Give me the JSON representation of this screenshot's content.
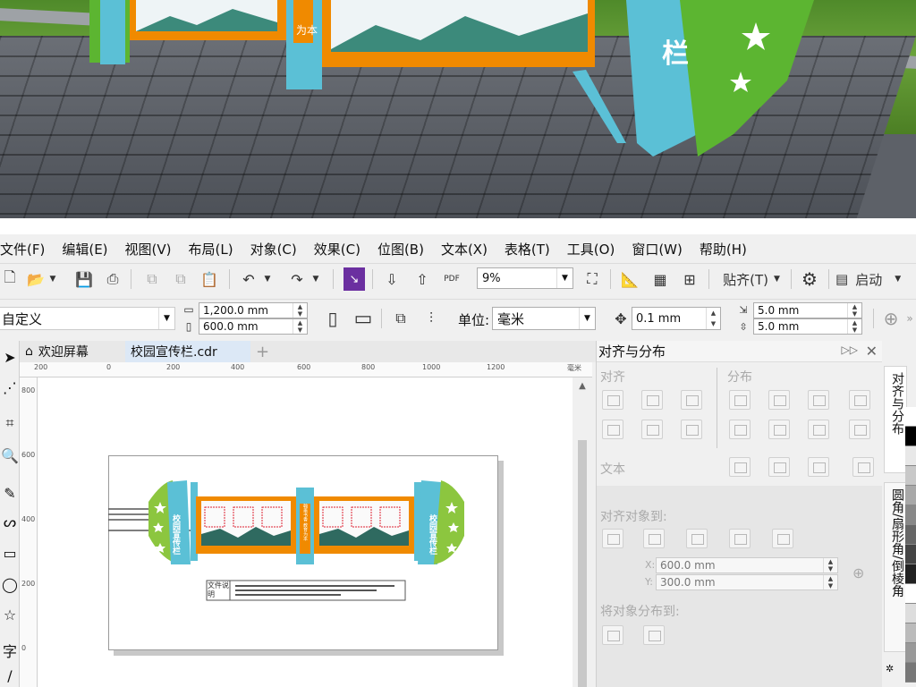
{
  "menu": [
    "文件(F)",
    "编辑(E)",
    "视图(V)",
    "布局(L)",
    "对象(C)",
    "效果(C)",
    "位图(B)",
    "文本(X)",
    "表格(T)",
    "工具(O)",
    "窗口(W)",
    "帮助(H)"
  ],
  "toolbar1": {
    "zoom": "9%",
    "snap_label": "贴齐(T)",
    "launch_label": "启动",
    "pdf_label": "PDF"
  },
  "toolbar2": {
    "preset": "自定义",
    "width": "1,200.0 mm",
    "height": "600.0 mm",
    "units_label": "单位:",
    "units_value": "毫米",
    "nudge": "0.1 mm",
    "dup_x": "5.0 mm",
    "dup_y": "5.0 mm"
  },
  "tabs": {
    "welcome": "欢迎屏幕",
    "document": "校园宣传栏.cdr"
  },
  "ruler": {
    "h_ticks": [
      "200",
      "0",
      "200",
      "400",
      "600",
      "800",
      "1000",
      "1200"
    ],
    "h_unit": "毫米",
    "v_ticks": [
      "800",
      "600",
      "400",
      "200",
      "0"
    ]
  },
  "artwork": {
    "side_title": "校园宣传栏",
    "side_title_right": "校园宣传栏",
    "center_text": "为本",
    "center_strip": "翰墨书香 教育为本",
    "caption_label": "文件说明"
  },
  "docker": {
    "title": "对齐与分布",
    "align_label": "对齐",
    "distribute_label": "分布",
    "text_label": "文本",
    "align_to_label": "对齐对象到:",
    "x_label": "X:",
    "x_value": "600.0 mm",
    "y_label": "Y:",
    "y_value": "300.0 mm",
    "distribute_to_label": "将对象分布到:"
  },
  "side_tabs": [
    "对齐与分布",
    "圆角/扇形角/倒棱角"
  ],
  "colors": {
    "accent": "#f08a00",
    "teal": "#5bc0d6",
    "green": "#5cb531",
    "menu_bg": "#f0f0f0"
  },
  "palette": [
    "#ffffff",
    "#000000",
    "#e8e8e8",
    "#c8c8c8",
    "#a8a8a8",
    "#888888",
    "#666666",
    "#444444",
    "#222222",
    "#ffffff",
    "#dddddd",
    "#bbbbbb",
    "#999999",
    "#777777"
  ]
}
